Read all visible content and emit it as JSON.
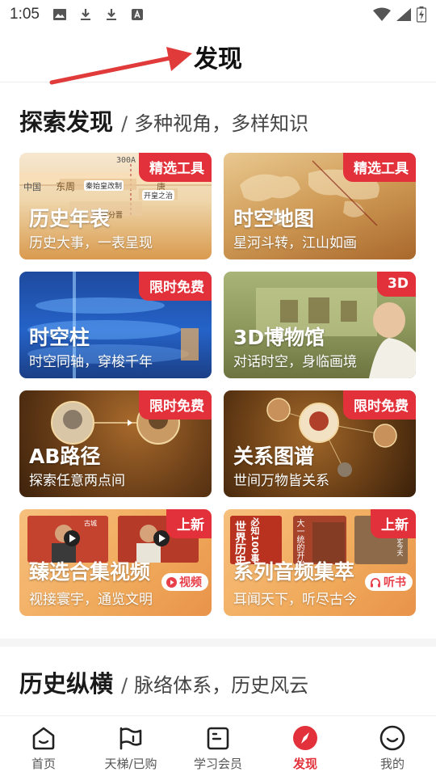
{
  "status_bar": {
    "time": "1:05"
  },
  "header": {
    "title": "发现"
  },
  "explore": {
    "title": "探索发现",
    "subtitle_slash": "/",
    "subtitle": "多种视角，多样知识",
    "cards": [
      {
        "title": "历史年表",
        "desc": "历史大事，一表呈现",
        "badge": "精选工具",
        "deco": {
          "label_300a": "300A",
          "zhongguo": "中国",
          "dongzhou": "东周",
          "qin": "秦始皇改制",
          "tang": "唐",
          "kaihuang": "开皇之治",
          "sanjia": "三家分晋"
        }
      },
      {
        "title": "时空地图",
        "desc": "星河斗转，江山如画",
        "badge": "精选工具"
      },
      {
        "title": "时空柱",
        "desc": "时空同轴，穿梭千年",
        "badge": "限时免费"
      },
      {
        "title": "3D博物馆",
        "desc": "对话时空，身临画境",
        "badge": "3D"
      },
      {
        "title": "AB路径",
        "desc": "探索任意两点间",
        "badge": "限时免费"
      },
      {
        "title": "关系图谱",
        "desc": "世间万物皆关系",
        "badge": "限时免费"
      },
      {
        "title": "臻选合集视频",
        "desc": "视接寰宇，通览文明",
        "badge": "上新",
        "tag": "视频",
        "deco": {
          "v1": "古城",
          "v2": ""
        }
      },
      {
        "title": "系列音频集萃",
        "desc": "耳闻天下，听尽古今",
        "badge": "上新",
        "tag": "听书",
        "deco": {
          "b1": "世界历史",
          "b2": "必知100事",
          "b3": "大一统的开始",
          "b4": "穿越历史今天"
        }
      }
    ]
  },
  "history": {
    "title": "历史纵横",
    "subtitle_slash": "/",
    "subtitle": "脉络体系，历史风云"
  },
  "bottom_nav": [
    {
      "label": "首页",
      "icon": "home-icon"
    },
    {
      "label": "天梯/已购",
      "icon": "flag-icon"
    },
    {
      "label": "学习会员",
      "icon": "book-icon"
    },
    {
      "label": "发现",
      "icon": "compass-icon",
      "active": true
    },
    {
      "label": "我的",
      "icon": "smile-icon"
    }
  ],
  "colors": {
    "accent": "#e2313a",
    "badge": "#e2313a"
  }
}
